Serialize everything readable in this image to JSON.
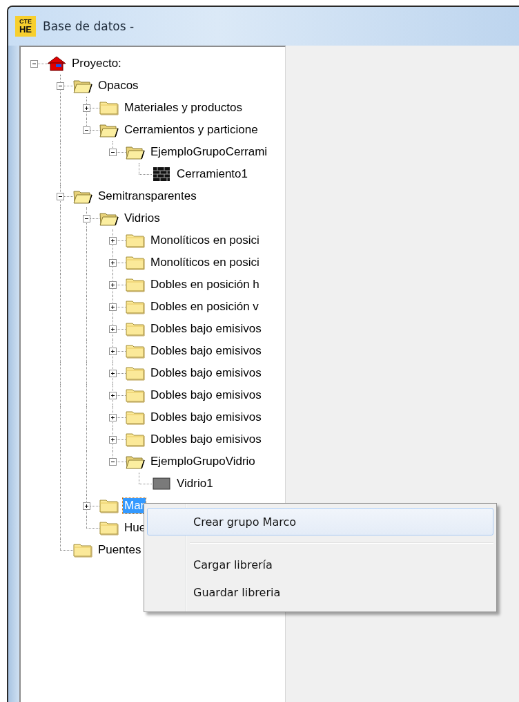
{
  "window": {
    "logo": {
      "top": "CTE",
      "bottom": "HE"
    },
    "title": "Base de datos -"
  },
  "tree": [
    {
      "label": "Proyecto:",
      "kind": "project",
      "expanded": true,
      "selected": false,
      "children": [
        {
          "label": "Opacos",
          "kind": "folder",
          "expanded": true,
          "selected": false,
          "children": [
            {
              "label": "Materiales y productos",
              "kind": "folder",
              "expanded": false,
              "selected": false
            },
            {
              "label": "Cerramientos y particione",
              "kind": "folder",
              "expanded": true,
              "selected": false,
              "children": [
                {
                  "label": "EjemploGrupoCerrami",
                  "kind": "folder",
                  "expanded": true,
                  "selected": false,
                  "children": [
                    {
                      "label": "Cerramiento1",
                      "kind": "wall",
                      "selected": false
                    }
                  ]
                }
              ]
            }
          ]
        },
        {
          "label": "Semitransparentes",
          "kind": "folder",
          "expanded": true,
          "selected": false,
          "children": [
            {
              "label": "Vidrios",
              "kind": "folder",
              "expanded": true,
              "selected": false,
              "children": [
                {
                  "label": "Monolíticos en posici",
                  "kind": "folder",
                  "expanded": false,
                  "selected": false
                },
                {
                  "label": "Monolíticos en posici",
                  "kind": "folder",
                  "expanded": false,
                  "selected": false
                },
                {
                  "label": "Dobles en posición h",
                  "kind": "folder",
                  "expanded": false,
                  "selected": false
                },
                {
                  "label": "Dobles en posición v",
                  "kind": "folder",
                  "expanded": false,
                  "selected": false
                },
                {
                  "label": "Dobles bajo emisivos",
                  "kind": "folder",
                  "expanded": false,
                  "selected": false
                },
                {
                  "label": "Dobles bajo emisivos",
                  "kind": "folder",
                  "expanded": false,
                  "selected": false
                },
                {
                  "label": "Dobles bajo emisivos",
                  "kind": "folder",
                  "expanded": false,
                  "selected": false
                },
                {
                  "label": "Dobles bajo emisivos",
                  "kind": "folder",
                  "expanded": false,
                  "selected": false
                },
                {
                  "label": "Dobles bajo emisivos",
                  "kind": "folder",
                  "expanded": false,
                  "selected": false
                },
                {
                  "label": "Dobles bajo emisivos",
                  "kind": "folder",
                  "expanded": false,
                  "selected": false
                },
                {
                  "label": "EjemploGrupoVidrio",
                  "kind": "folder",
                  "expanded": true,
                  "selected": false,
                  "children": [
                    {
                      "label": "Vidrio1",
                      "kind": "glass",
                      "selected": false
                    }
                  ]
                }
              ]
            },
            {
              "label": "Mar",
              "kind": "folder",
              "expanded": false,
              "selected": true
            },
            {
              "label": "Hue",
              "kind": "folder",
              "selected": false
            }
          ]
        },
        {
          "label": "Puentes",
          "kind": "folder",
          "selected": false
        }
      ]
    }
  ],
  "context_menu": {
    "items": [
      {
        "kind": "command",
        "label": "Crear grupo Marco",
        "selected": true
      },
      {
        "kind": "separator"
      },
      {
        "kind": "command",
        "label": "Cargar librería",
        "selected": false
      },
      {
        "kind": "command",
        "label": "Guardar libreria",
        "selected": false
      }
    ]
  }
}
